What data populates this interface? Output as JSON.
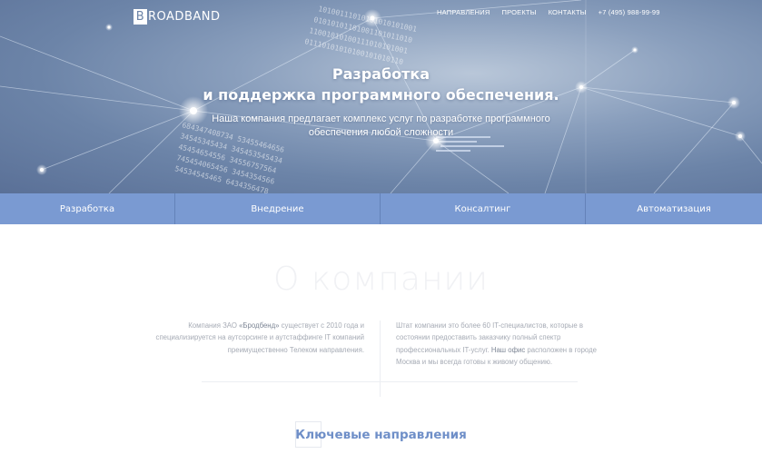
{
  "header": {
    "logo_mark": "B",
    "logo_rest": "ROADBAND",
    "nav": [
      "НАПРАВЛЕНИЯ",
      "ПРОЕКТЫ",
      "КОНТАКТЫ"
    ],
    "phone": "+7 (495) 988-99-99"
  },
  "hero": {
    "title_line1": "Разработка",
    "title_line2": "и поддержка программного обеспечения.",
    "subtitle_line1": "Наша компания предлагает комплекс услуг по разработке программного",
    "subtitle_line2": "обеспечения любой сложности"
  },
  "tabs": [
    "Разработка",
    "Внедрение",
    "Консалтинг",
    "Автоматизация"
  ],
  "about": {
    "title": "О компании",
    "left": {
      "p1": "Компания ЗАО ",
      "brand": "«Бродбенд»",
      "p2": " существует с 2010 года и специализируется на аутсорсинге и аутстаффинге IT компаний преимущественно Телеком направления."
    },
    "right": {
      "p1": "Штат компании это более 60 IT-специалистов, которые в состоянии предоставить заказчику полный спектр профессиональных IT-услуг. ",
      "office": "Наш офис",
      "p2": " расположен в городе Москва и мы всегда готовы к живому общению."
    }
  },
  "directions": {
    "title": "Ключевые направления"
  },
  "colors": {
    "accent": "#7a9ad2",
    "hero_base": "#6c84a8",
    "heading_blue": "#6f8fc8"
  }
}
